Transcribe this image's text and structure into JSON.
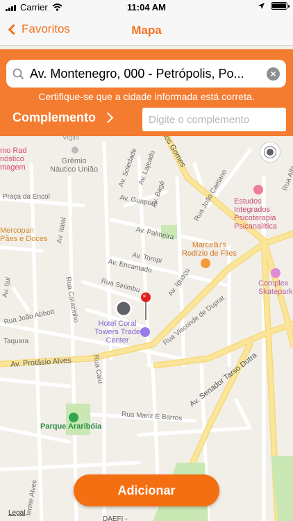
{
  "status_bar": {
    "carrier": "Carrier",
    "time": "11:04 AM"
  },
  "nav": {
    "back_label": "Favoritos",
    "title": "Mapa"
  },
  "search": {
    "value": "Av. Montenegro, 000 - Petrópolis, Po..."
  },
  "warning": "Certifique-se que a cidade informada está correta.",
  "complemento": {
    "label": "Complemento",
    "placeholder": "Digite o complemento"
  },
  "map": {
    "places": {
      "rad_line1": "mo Rad",
      "rad_line2": "nóstico",
      "rad_line3": "magem",
      "gremio_line1": "Grêmio",
      "gremio_line2": "Náutico União",
      "vigilo": "Vigilo",
      "mercopan_line1": "Mercopan",
      "mercopan_line2": "Pães e Doces",
      "estudos_line1": "Estudos",
      "estudos_line2": "Integrados",
      "estudos_line3": "Psicoterapia",
      "estudos_line4": "Psicanalítica",
      "marcellus_line1": "Marcellu's",
      "marcellus_line2": "Rodízio de Files",
      "complex_line1": "Complex",
      "complex_line2": "Skatepark",
      "hotel_line1": "Hotel Coral",
      "hotel_line2": "Towers Trade",
      "hotel_line3": "Center",
      "parque": "Parque Araribóia",
      "daefi": "DAEFI -"
    },
    "streets": {
      "praca_encol": "Praça da Encol",
      "soledade": "Av. Soledade",
      "lajeado": "Av. Lajeado",
      "guapore": "Av. Guaporé",
      "bage": "Av. Bagé",
      "palmeira": "Av. Palmeira",
      "toropi": "Av. Toropi",
      "encantado": "Av. Encantado",
      "itaiai": "Av. Itaiaí",
      "ijui": "Av. Ijuí",
      "joao_abbott": "Rua João Abbott",
      "carazinho": "Rua Carazinho",
      "sinimbu": "Rua Sinimbu",
      "taquara": "Taquara",
      "protasio": "Av. Protásio Alves",
      "iguacu": "Av. Iguaçu",
      "visconde": "Rua Visconde de Duprat",
      "joao_caetano": "Rua João Caetano",
      "gomes": "los Gomes",
      "senador": "Av. Senador Tarso Dutra",
      "mariz": "Rua Mariz E Barros",
      "caiu": "Rua Caiu",
      "alfa": "Rua Alfa",
      "lerme": "lerme Alves"
    },
    "legal": "Legal"
  },
  "add_button": "Adicionar",
  "colors": {
    "accent": "#f47c31",
    "button": "#f46f12",
    "map_bg": "#f2efe9",
    "road_major": "#fbe59a",
    "park": "#c9e8b4"
  }
}
